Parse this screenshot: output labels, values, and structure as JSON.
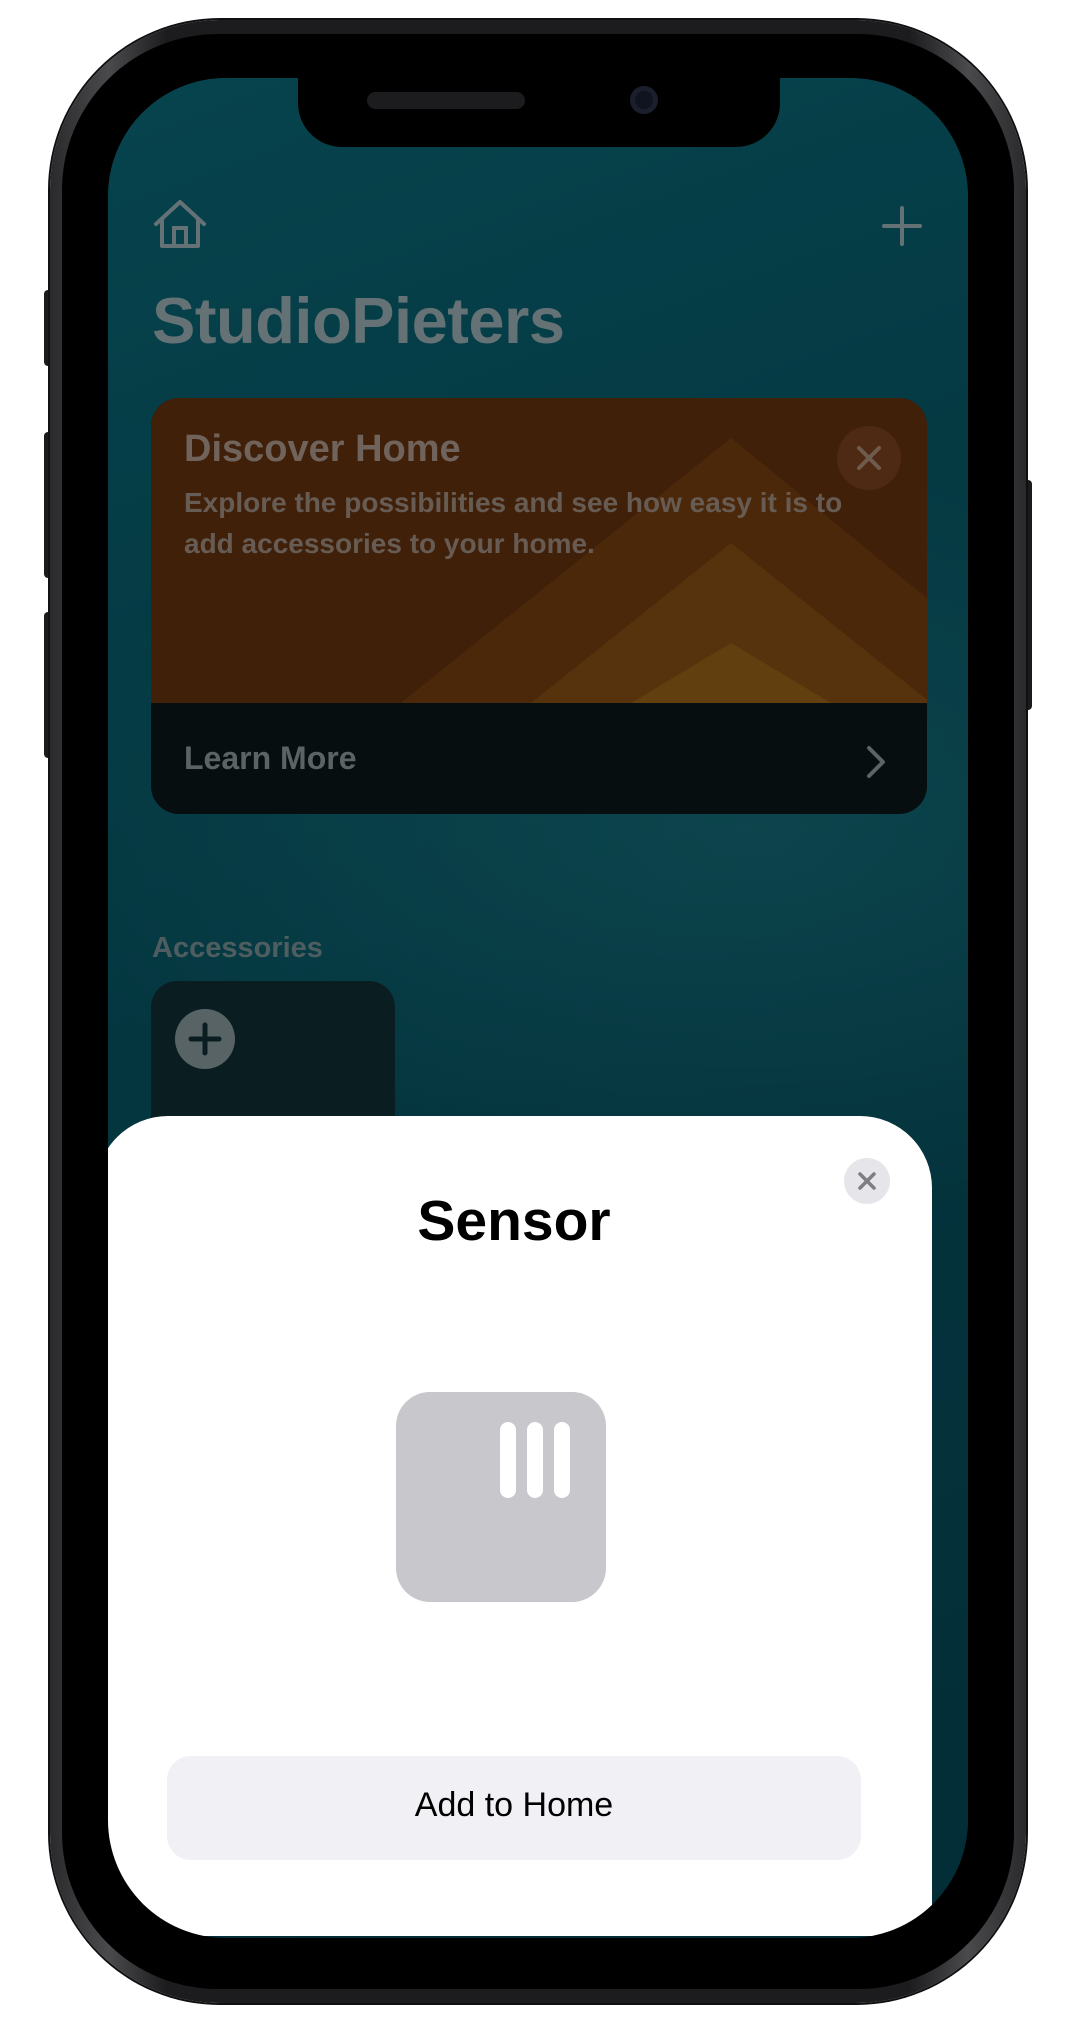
{
  "home": {
    "title": "StudioPieters",
    "discover": {
      "title": "Discover Home",
      "text": "Explore the possibilities and see how easy it is to add accessories to your home.",
      "link_label": "Learn More"
    },
    "accessories_title": "Accessories"
  },
  "sheet": {
    "title": "Sensor",
    "icon": "sensor-icon",
    "button_label": "Add to Home"
  },
  "colors": {
    "wallpaper": "#07515e",
    "discover_banner": "#5a2d0f",
    "sheet_background": "#ffffff",
    "button_background": "#f0f0f5",
    "sensor_tile": "#c7c7cc"
  }
}
